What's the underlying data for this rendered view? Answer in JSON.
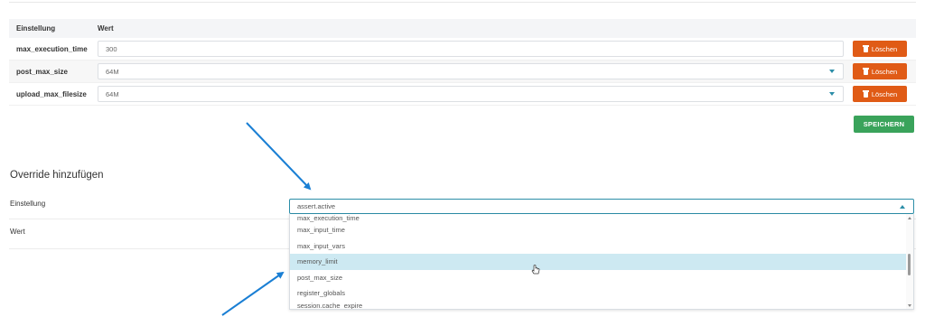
{
  "table": {
    "headers": [
      "Einstellung",
      "Wert"
    ],
    "rows": [
      {
        "setting": "max_execution_time",
        "value": "300",
        "has_dropdown": false,
        "delete_label": "Löschen"
      },
      {
        "setting": "post_max_size",
        "value": "64M",
        "has_dropdown": true,
        "delete_label": "Löschen"
      },
      {
        "setting": "upload_max_filesize",
        "value": "64M",
        "has_dropdown": true,
        "delete_label": "Löschen"
      }
    ]
  },
  "save_label": "SPEICHERN",
  "override": {
    "title": "Override hinzufügen",
    "setting_label": "Einstellung",
    "value_label": "Wert",
    "selected": "assert.active",
    "options": [
      "max_execution_time",
      "max_input_time",
      "max_input_vars",
      "memory_limit",
      "post_max_size",
      "register_globals",
      "session.cache_expire"
    ],
    "highlighted": "memory_limit"
  },
  "colors": {
    "delete": "#e05b16",
    "save": "#3aa35b",
    "accent": "#2c8ea8",
    "highlight": "#cde9f2",
    "annotation_arrow": "#1a7fd4"
  },
  "icons": [
    "trash-icon",
    "chevron-down-icon",
    "chevron-up-icon",
    "hand-pointer-icon"
  ]
}
